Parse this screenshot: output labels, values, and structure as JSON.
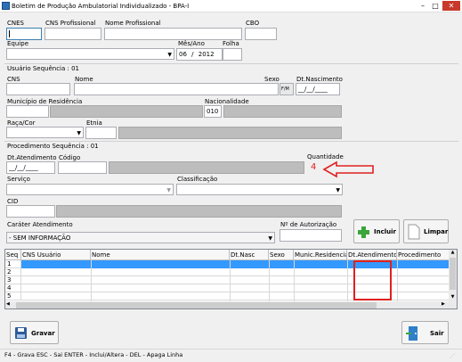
{
  "window": {
    "title": "Boletim de Produção Ambulatorial Individualizado - BPA-I"
  },
  "header": {
    "cnes_label": "CNES",
    "cns_prof_label": "CNS Profissional",
    "nome_prof_label": "Nome Profissional",
    "cbo_label": "CBO",
    "equipe_label": "Equipe",
    "mes_ano_label": "Mês/Ano",
    "mes_value": "06",
    "slash": "/",
    "ano_value": "2012",
    "folha_label": "Folha"
  },
  "usuario": {
    "section_label": "Usuário Sequência : 01",
    "cns_label": "CNS",
    "nome_label": "Nome",
    "sexo_label": "Sexo",
    "sexo_hint": "F/M",
    "nasc_label": "Dt.Nascimento",
    "nasc_value": "__/__/____",
    "municipio_label": "Município de Residência",
    "nacionalidade_label": "Nacionalidade",
    "nacionalidade_value": "010",
    "raca_label": "Raça/Cor",
    "etnia_label": "Etnia"
  },
  "procedimento": {
    "section_label": "Procedimento Sequência : 01",
    "dt_atend_label": "Dt.Atendimento",
    "dt_atend_value": "__/__/____",
    "codigo_label": "Código",
    "quantidade_label": "Quantidade",
    "quantidade_value": "4",
    "servico_label": "Serviço",
    "classificacao_label": "Classificação",
    "cid_label": "CID",
    "carater_label": "Caráter Atendimento",
    "carater_value": "- SEM INFORMAÇÃO",
    "autorizacao_label": "Nº de Autorização",
    "incluir_label": "Incluir",
    "limpar_label": "Limpar"
  },
  "table": {
    "columns": [
      "Seq",
      "CNS Usuário",
      "Nome",
      "Dt.Nasc",
      "Sexo",
      "Munic.Residencia",
      "Dt.Atendimento",
      "Procedimento"
    ],
    "rows": [
      "1",
      "2",
      "3",
      "4",
      "5"
    ]
  },
  "footer": {
    "gravar_label": "Gravar",
    "sair_label": "Sair",
    "status": "F4 - Grava   ESC - Sai   ENTER - Inclui/Altera  - DEL - Apaga Linha"
  },
  "colors": {
    "annotation": "#e02020",
    "selected_row": "#3399ff"
  }
}
